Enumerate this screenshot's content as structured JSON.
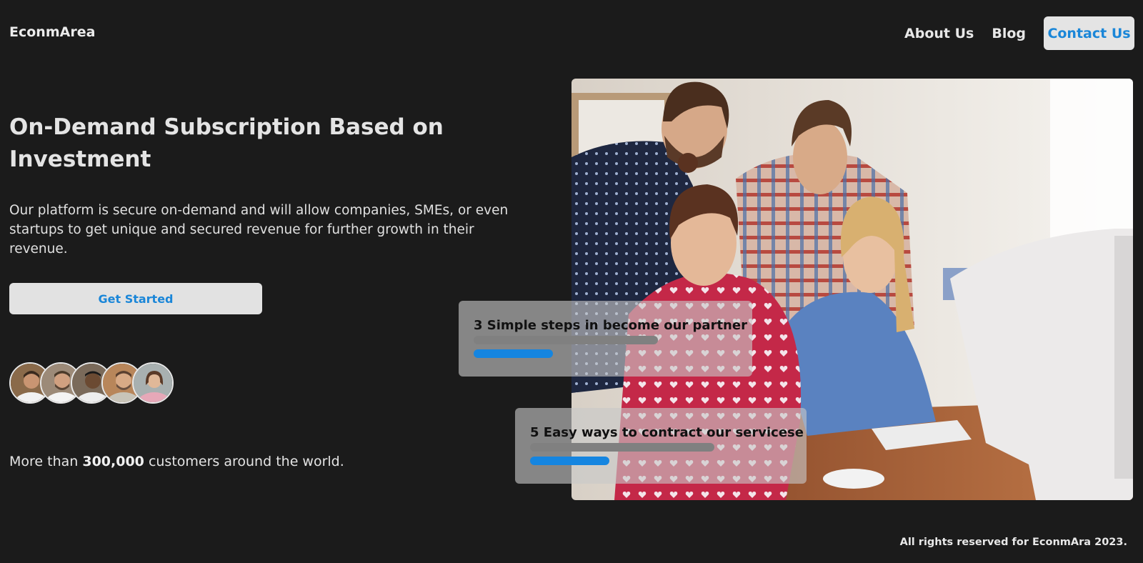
{
  "nav": {
    "brand": "EconmArea",
    "links": [
      "About Us",
      "Blog"
    ],
    "contact_label": "Contact Us"
  },
  "hero": {
    "title": "On-Demand Subscription Based on Investment",
    "description": "Our platform is secure on-demand and will allow companies, SMEs, or even startups to get unique and secured revenue for further growth in their revenue.",
    "cta_label": "Get Started"
  },
  "customers": {
    "prefix": "More than ",
    "count": "300,000",
    "suffix": " customers around the world."
  },
  "steps": [
    {
      "title": "3 Simple steps in become our partner",
      "progress": 0.43
    },
    {
      "title": "5 Easy ways to contract our servicese",
      "progress": 0.43
    }
  ],
  "footer": {
    "copyright": "All rights reserved for EconmAra 2023."
  },
  "colors": {
    "background": "#1b1b1b",
    "accent": "#1585e0",
    "button_bg": "#e2e2e2"
  }
}
